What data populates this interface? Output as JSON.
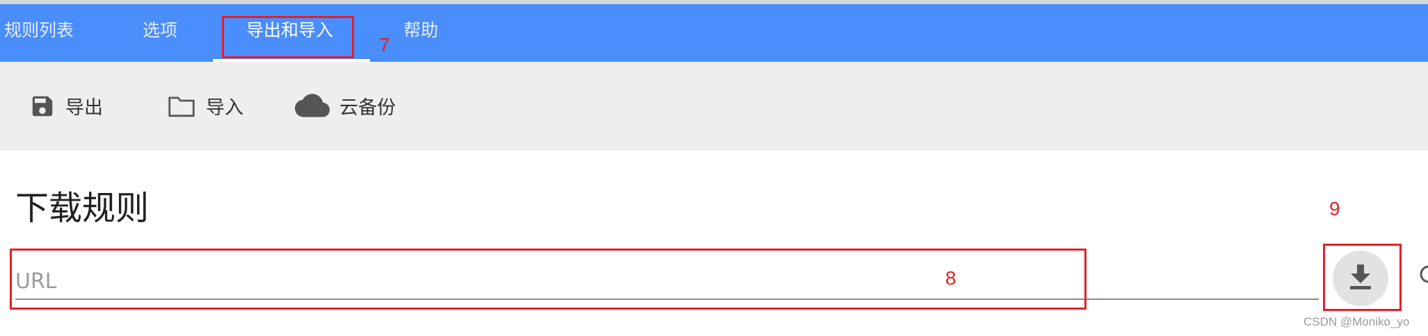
{
  "tabs": [
    {
      "label": "规则列表"
    },
    {
      "label": "选项"
    },
    {
      "label": "导出和导入",
      "active": true
    },
    {
      "label": "帮助"
    }
  ],
  "toolbar": {
    "export_label": "导出",
    "import_label": "导入",
    "cloud_backup_label": "云备份"
  },
  "download_rules": {
    "title": "下载规则",
    "url_placeholder": "URL",
    "url_value": ""
  },
  "annotations": {
    "tab_marker": "7",
    "input_marker": "8",
    "button_marker": "9"
  },
  "watermark": "CSDN @Moniko_yo",
  "colors": {
    "tab_bar": "#4a8dfd",
    "toolbar_bg": "#eeeeee",
    "annotation": "#e41f26"
  }
}
